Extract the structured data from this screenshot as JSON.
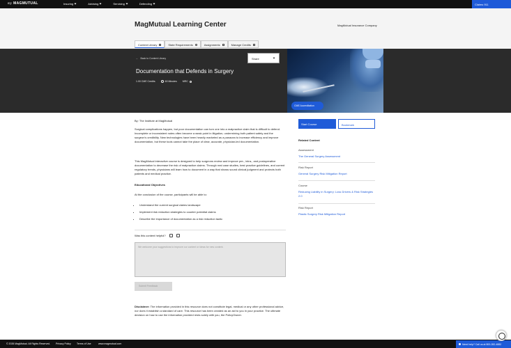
{
  "topnav": {
    "logo_prefix": "my",
    "logo_brand": "MAGMUTUAL",
    "items": [
      "Insuring",
      "Advising",
      "Servicing",
      "Defending"
    ],
    "claims_button": "Claims 911"
  },
  "header": {
    "title": "MagMutual Learning Center",
    "company": "MagMutual Insurance Company",
    "tabs": [
      "Content Library",
      "State Requirements",
      "Assignments",
      "Manage Credits"
    ]
  },
  "hero": {
    "back_label": "Back to Content Library",
    "share_label": "Share",
    "title": "Documentation that Defends in Surgery",
    "credits": "1.00 CME Credits",
    "duration": "60 Minutes",
    "mrc": "MRC",
    "cme_pill": "CME Accreditation"
  },
  "content": {
    "byline": "By: The Institute at MagMutual",
    "para1": "Surgical complications happen, but poor documentation can turn one into a malpractice claim that is difficult to defend. Incomplete or inconsistent notes often become a weak point in litigation, undermining both patient safety and the surgeon's credibility. New technologies have been heavily marketed as a panacea to increase efficiency and improve documentation, but these tools cannot take the place of clear, accurate, physician-led documentation.",
    "para2": "This MagMutual interactive course is designed to help surgeons review and improve pre-, intra-, and postoperative documentation to decrease the risk of malpractice claims. Through real case studies, best practice guidelines, and current regulatory trends, physicians will learn how to document in a way that shows sound clinical judgment and protects both patients and medical practice.",
    "objectives_heading": "Educational Objectives",
    "objectives_intro": "At the conclusion of the course, participants will be able to:",
    "objectives": [
      "Understand the current surgical claims landscape",
      "Implement risk reduction strategies to counter potential claims",
      "Describe the importance of documentation as a risk reduction tactic"
    ],
    "helpful_label": "Was this content helpful?",
    "feedback_placeholder": "We welcome your suggestions to improve our content or ideas for new content.",
    "submit_label": "Submit Feedback",
    "disclaimer_label": "Disclaimer:",
    "disclaimer_text": " The information provided in this resource does not constitute legal, medical or any other professional advice, nor does it establish a standard of care. This resource has been created as an aid to you in your practice. The ultimate decision on how to use the information provided rests solely with you, the PolicyOwner."
  },
  "sidebar": {
    "start_label": "Start Course",
    "bookmark_label": "Bookmark",
    "related_heading": "Related Content",
    "related": [
      {
        "type": "Assessment",
        "title": "The General Surgery Assessment"
      },
      {
        "type": "Risk Report",
        "title": "General Surgery Risk Mitigation Report"
      },
      {
        "type": "Course",
        "title": "Reducing Liability in Surgery: Loss Drivers & Risk Strategies 2.0"
      },
      {
        "type": "Risk Report",
        "title": "Plastic Surgery Risk Mitigation Report"
      }
    ]
  },
  "footer": {
    "copyright": "© 2026 MagMutual. All Rights Reserved.",
    "privacy": "Privacy Policy",
    "terms": "Terms of Use",
    "site": "www.magmutual.com",
    "help": "Need help? Call us at 800-282-4882"
  },
  "colors": {
    "accent": "#1f5bd8",
    "nav_bg": "#111111",
    "hero_bg": "#2b2b2b"
  }
}
